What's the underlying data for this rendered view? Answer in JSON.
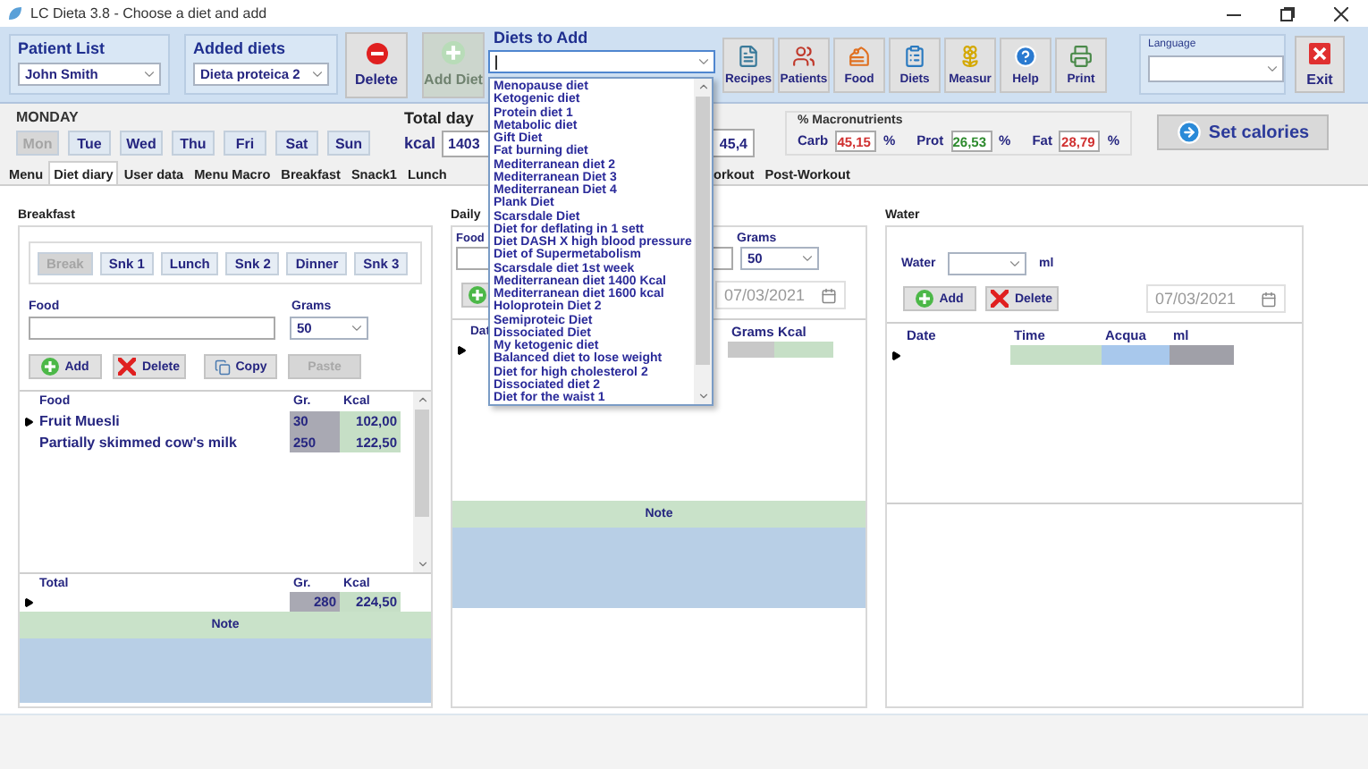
{
  "window": {
    "title": "LC Dieta 3.8 - Choose a diet and add"
  },
  "toolbar": {
    "patient_list": {
      "label": "Patient List",
      "value": "John Smith"
    },
    "added_diets": {
      "label": "Added diets",
      "value": "Dieta proteica 2"
    },
    "delete_button": {
      "label": "Delete"
    },
    "add_diet_button": {
      "label": "Add Diet",
      "disabled": true
    },
    "diets_to_add": {
      "label": "Diets to Add",
      "expanded": true,
      "options": [
        "Menopause diet",
        "Ketogenic diet",
        "Protein diet 1",
        "Metabolic diet",
        "Gift Diet",
        "Fat burning diet",
        "Mediterranean diet 2",
        "Mediterranean Diet 3",
        "Mediterranean Diet 4",
        "Plank Diet",
        "Scarsdale Diet",
        "Diet for deflating in 1 sett",
        "Diet DASH X high blood pressure",
        "Diet of Supermetabolism",
        "Scarsdale diet 1st week",
        "Mediterranean diet 1400 Kcal",
        "Mediterranean diet 1600 kcal",
        "Holoprotein Diet 2",
        "Semiproteic Diet",
        "Dissociated Diet",
        "My ketogenic diet",
        "Balanced diet to lose weight",
        "Diet for high cholesterol 2",
        "Dissociated diet 2",
        "Diet for the waist 1"
      ]
    },
    "buttons": [
      {
        "label": "Recipes"
      },
      {
        "label": "Patients"
      },
      {
        "label": "Food"
      },
      {
        "label": "Diets"
      },
      {
        "label": "Measur"
      },
      {
        "label": "Help"
      },
      {
        "label": "Print"
      }
    ],
    "language": {
      "label": "Language"
    },
    "exit_button": {
      "label": "Exit"
    }
  },
  "day": {
    "label": "MONDAY",
    "days": [
      {
        "label": "Mon",
        "selected": true
      },
      {
        "label": "Tue",
        "selected": false
      },
      {
        "label": "Wed",
        "selected": false
      },
      {
        "label": "Thu",
        "selected": false
      },
      {
        "label": "Fri",
        "selected": false
      },
      {
        "label": "Sat",
        "selected": false
      },
      {
        "label": "Sun",
        "selected": false
      }
    ]
  },
  "totals": {
    "label": "Total day",
    "unit": "kcal",
    "kcal": "1403",
    "field_2": "45,4"
  },
  "macros": {
    "title": "% Macronutrients",
    "items": [
      {
        "label": "Carb",
        "value": "45,15",
        "unit": "%",
        "color": "#d03030"
      },
      {
        "label": "Prot",
        "value": "26,53",
        "unit": "%",
        "color": "#2e8b2e"
      },
      {
        "label": "Fat",
        "value": "28,79",
        "unit": "%",
        "color": "#d03030"
      }
    ]
  },
  "set_calories_button": {
    "label": "Set calories"
  },
  "tabs": {
    "before_dropdown": [
      {
        "label": "Menu",
        "selected": false
      },
      {
        "label": "Diet diary",
        "selected": true
      },
      {
        "label": "User data",
        "selected": false
      },
      {
        "label": "Menu Macro",
        "selected": false
      },
      {
        "label": "Breakfast",
        "selected": false
      },
      {
        "label": "Snack1",
        "selected": false
      },
      {
        "label": "Lunch",
        "selected": false
      }
    ],
    "after_dropdown": [
      {
        "label": "orkout",
        "selected": false
      },
      {
        "label": "Post-Workout",
        "selected": false
      }
    ]
  },
  "breakfast": {
    "title": "Breakfast",
    "meals": [
      {
        "label": "Break",
        "selected": true
      },
      {
        "label": "Snk 1",
        "selected": false
      },
      {
        "label": "Lunch",
        "selected": false
      },
      {
        "label": "Snk 2",
        "selected": false
      },
      {
        "label": "Dinner",
        "selected": false
      },
      {
        "label": "Snk 3",
        "selected": false
      }
    ],
    "food_label": "Food",
    "grams_label": "Grams",
    "grams_value": "50",
    "buttons": [
      {
        "label": "Add",
        "disabled": false
      },
      {
        "label": "Delete",
        "disabled": false
      },
      {
        "label": "Copy",
        "disabled": false
      },
      {
        "label": "Paste",
        "disabled": true
      }
    ],
    "table": {
      "columns": [
        "Food",
        "Gr.",
        "Kcal"
      ],
      "rows": [
        {
          "food": "Fruit Muesli",
          "grams": "30",
          "kcal": "102,00",
          "current": true
        },
        {
          "food": "Partially skimmed cow's milk",
          "grams": "250",
          "kcal": "122,50",
          "current": false
        }
      ]
    },
    "total": {
      "columns": [
        "Total",
        "Gr.",
        "Kcal"
      ],
      "grams": "280",
      "kcal": "224,50"
    },
    "note": "Note"
  },
  "daily": {
    "title": "Daily",
    "food_label": "Food",
    "grams_label": "Grams",
    "grams_value": "50",
    "date": "07/03/2021",
    "columns": [
      "Dat",
      "Grams",
      "Kcal"
    ],
    "note": "Note"
  },
  "water": {
    "title": "Water",
    "water_label": "Water",
    "unit": "ml",
    "buttons": [
      {
        "label": "Add"
      },
      {
        "label": "Delete"
      }
    ],
    "date": "07/03/2021",
    "columns": [
      "Date",
      "Time",
      "Acqua",
      "ml"
    ]
  }
}
